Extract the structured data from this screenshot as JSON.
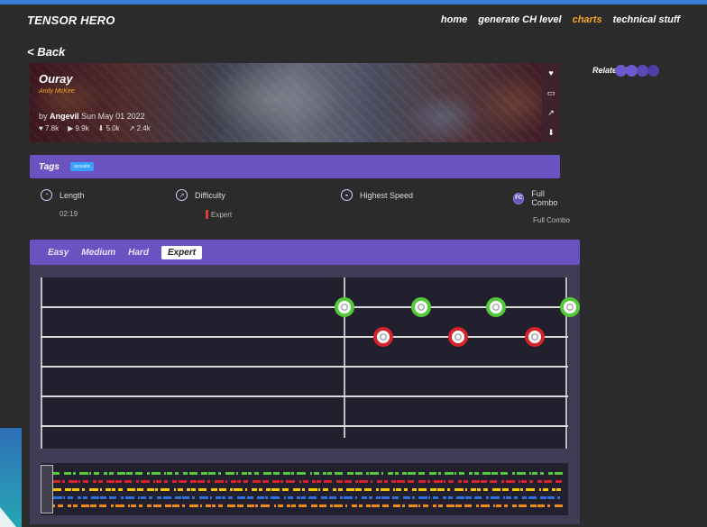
{
  "nav": {
    "brand": "TENSOR HERO",
    "links": [
      {
        "label": "home",
        "active": false
      },
      {
        "label": "generate CH level",
        "active": false
      },
      {
        "label": "charts",
        "active": true
      },
      {
        "label": "technical stuff",
        "active": false
      }
    ]
  },
  "back_label": "< Back",
  "song": {
    "title": "Ouray",
    "artist": "Andy McKee",
    "by_prefix": "by",
    "charter": "Angevil",
    "date": "Sun May 01 2022",
    "stats": {
      "likes": "7.8k",
      "plays": "9.9k",
      "downloads": "5.0k",
      "shares": "2.4k"
    },
    "side_icons": [
      "heart-icon",
      "comment-icon",
      "share-icon",
      "download-icon"
    ]
  },
  "related_label": "Related Charts",
  "tags": {
    "label": "Tags",
    "items": [
      "acoustic"
    ]
  },
  "info": {
    "length": {
      "label": "Length",
      "value": "02:19"
    },
    "difficulty": {
      "label": "Difficulty",
      "value": "Expert"
    },
    "speed": {
      "label": "Highest Speed",
      "value": ""
    },
    "fullcombo": {
      "label": "Full Combo",
      "value": "Full Combo",
      "badge": "FC"
    }
  },
  "difficulties": [
    {
      "label": "Easy",
      "active": false
    },
    {
      "label": "Medium",
      "active": false
    },
    {
      "label": "Hard",
      "active": false
    },
    {
      "label": "Expert",
      "active": true
    }
  ],
  "colors": {
    "accent": "#6a53c1",
    "brand_orange": "#f5a623",
    "green_note": "#54c93b",
    "red_note": "#d4242b",
    "yellow_note": "#f5c400",
    "blue_note": "#2f6fdb",
    "orange_note": "#f08a1c"
  }
}
